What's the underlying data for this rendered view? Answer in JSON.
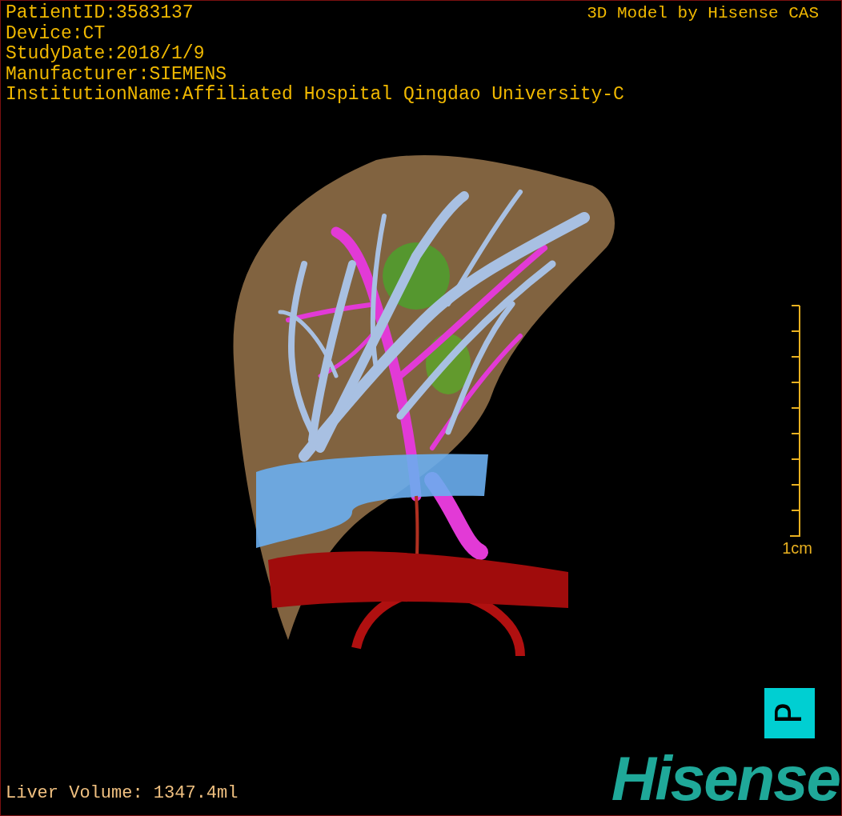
{
  "patient_info": [
    "PatientID:3583137",
    "Device:CT",
    "StudyDate:2018/1/9",
    "Manufacturer:SIEMENS",
    "InstitutionName:Affiliated Hospital Qingdao University-C"
  ],
  "title": "3D Model by Hisense CAS",
  "scale_bar": {
    "label": "1cm"
  },
  "orientation_marker": {
    "label": "P"
  },
  "liver_volume": "Liver Volume: 1347.4ml",
  "logo": "Hisense"
}
